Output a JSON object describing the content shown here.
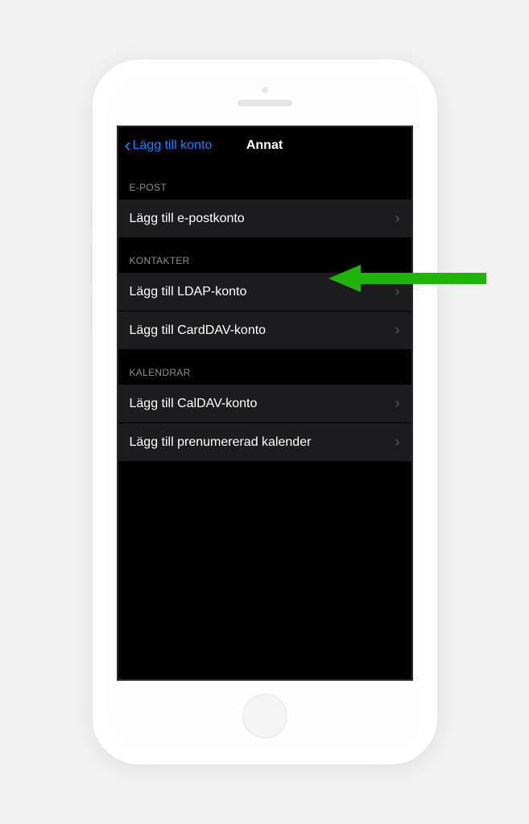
{
  "nav": {
    "back_label": "Lägg till konto",
    "title": "Annat"
  },
  "sections": {
    "email": {
      "header": "E-POST",
      "add_email_account": "Lägg till e-postkonto"
    },
    "contacts": {
      "header": "KONTAKTER",
      "add_ldap": "Lägg till LDAP-konto",
      "add_carddav": "Lägg till CardDAV-konto"
    },
    "calendars": {
      "header": "KALENDRAR",
      "add_caldav": "Lägg till CalDAV-konto",
      "add_subscribed": "Lägg till prenumererad kalender"
    }
  },
  "annotation": {
    "arrow_color": "#1fb40a"
  }
}
